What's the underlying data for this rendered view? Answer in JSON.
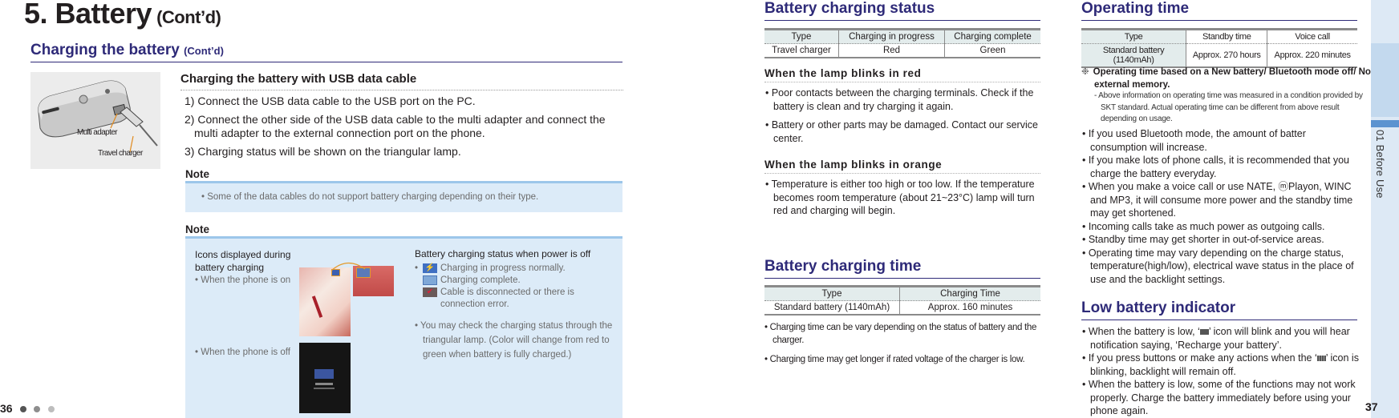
{
  "page_title": {
    "main": "5. Battery",
    "suffix": "(Cont’d)"
  },
  "left_page": {
    "section_title": "Charging the battery",
    "section_suffix": "(Cont’d)",
    "illustration": {
      "multi_adapter_label": "Multi adapter",
      "travel_charger_label": "Travel charger"
    },
    "usb_heading": "Charging the battery with USB data cable",
    "steps": [
      "1) Connect the USB data cable to the USB port on the PC.",
      "2) Connect the other side of the USB data cable to the multi adapter and connect the multi adapter to the external connection port on the phone.",
      "3) Charging status will be shown on the triangular lamp."
    ],
    "note1": {
      "title": "Note",
      "text": "• Some of the data cables do not support battery charging depending on their type."
    },
    "note2": {
      "title": "Note",
      "icons_heading": "Icons displayed during battery charging",
      "phone_on": "• When the phone is on",
      "phone_off": "• When the phone is off",
      "status_heading": "Battery charging status when power is off",
      "status_items": [
        "Charging in progress normally.",
        "Charging complete.",
        "Cable is disconnected or there is connection error."
      ],
      "lamp_text": "• You may check the charging status through the triangular lamp. (Color will change from red to green when battery is fully charged.)"
    },
    "page_number": "36"
  },
  "charging_status": {
    "title": "Battery charging status",
    "table": {
      "headers": [
        "Type",
        "Charging in progress",
        "Charging complete"
      ],
      "rows": [
        [
          "Travel charger",
          "Red",
          "Green"
        ]
      ]
    },
    "red_heading": "When the lamp blinks in red",
    "red_items": [
      "• Poor contacts between the charging terminals. Check if the battery is clean and try charging it again.",
      "• Battery or other parts may be damaged. Contact our service center."
    ],
    "orange_heading": "When the lamp blinks in orange",
    "orange_items": [
      "• Temperature is either too high or too low. If the temperature becomes room temperature (about 21~23°C) lamp will turn red and charging will begin."
    ]
  },
  "charging_time": {
    "title": "Battery charging time",
    "table": {
      "headers": [
        "Type",
        "Charging Time"
      ],
      "rows": [
        [
          "Standard battery (1140mAh)",
          "Approx. 160 minutes"
        ]
      ]
    },
    "items": [
      "• Charging time can be vary depending on the status of battery and the charger.",
      "• Charging time may get longer if rated voltage of the charger is low."
    ]
  },
  "operating_time": {
    "title": "Operating time",
    "table": {
      "headers": [
        "Type",
        "Standby time",
        "Voice call"
      ],
      "rows": [
        [
          "Standard battery (1140mAh)",
          "Approx. 270 hours",
          "Approx. 220 minutes"
        ]
      ]
    },
    "footnote_symbol": "❉",
    "footnote_bold": "Operating time based on a New battery/ Bluetooth mode off/ No external memory.",
    "footnote_detail": "- Above information on operating time was measured in a condition provided by SKT standard. Actual operating time can be different from above result depending on usage.",
    "items": [
      "• If you used Bluetooth mode, the amount of batter consumption will increase.",
      "• If you make lots of phone calls, it is recommended that you charge the battery everyday.",
      "• When you make a voice call or use NATE, ⓜPlayon, WINC and MP3, it will consume more power and the standby time may get shortened.",
      "• Incoming calls take as much power as outgoing calls.",
      "• Standby time may get shorter in out-of-service areas.",
      "• Operating time may vary depending on the charge status, temperature(high/low), electrical wave status in the place of use and the backlight settings."
    ]
  },
  "low_battery": {
    "title": "Low battery indicator",
    "item1_pre": "• When the battery is low, ‘",
    "item1_post": "’ icon will blink and you will hear notification saying,  ‘Recharge your battery’.",
    "item2_pre": "• If you press buttons or make any actions when the ‘",
    "item2_post": "’ icon is blinking, backlight will remain off.",
    "item3": "• When the battery is low, some of the functions may not work properly. Charge the battery immediately before using your phone again."
  },
  "sidebar": {
    "chapter_label": "01 Before Use"
  },
  "right_page_number": "37",
  "colors": {
    "heading": "#2e2a78",
    "note_bg": "#dcebf8",
    "note_rule": "#9cc6ea",
    "sidebar_bg": "#dde9f5",
    "sidebar_tab": "#5b93d0"
  }
}
